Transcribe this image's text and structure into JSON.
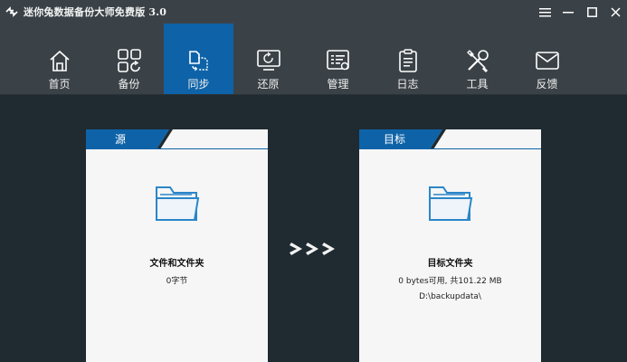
{
  "window": {
    "title": "迷你兔数据备份大师免费版 3.0",
    "controls": [
      "menu-icon",
      "minimize-icon",
      "maximize-icon",
      "close-icon"
    ]
  },
  "toolbar": {
    "items": [
      {
        "label": "首页",
        "icon": "home-icon",
        "active": false
      },
      {
        "label": "备份",
        "icon": "backup-icon",
        "active": false
      },
      {
        "label": "同步",
        "icon": "sync-icon",
        "active": true
      },
      {
        "label": "还原",
        "icon": "restore-icon",
        "active": false
      },
      {
        "label": "管理",
        "icon": "manage-icon",
        "active": false
      },
      {
        "label": "日志",
        "icon": "log-icon",
        "active": false
      },
      {
        "label": "工具",
        "icon": "tools-icon",
        "active": false
      },
      {
        "label": "反馈",
        "icon": "feedback-icon",
        "active": false
      }
    ]
  },
  "source": {
    "tab_label": "源",
    "name": "文件和文件夹",
    "info": "0字节"
  },
  "destination": {
    "tab_label": "目标",
    "name": "目标文件夹",
    "info": "0 bytes可用, 共101.22 MB",
    "path": "D:\\backupdata\\"
  },
  "colors": {
    "accent": "#0e63a8",
    "toolbar_bg": "#3b4247",
    "content_bg": "#1f2a31",
    "panel_bg": "#f6f6f6",
    "folder": "#2b86c8"
  }
}
